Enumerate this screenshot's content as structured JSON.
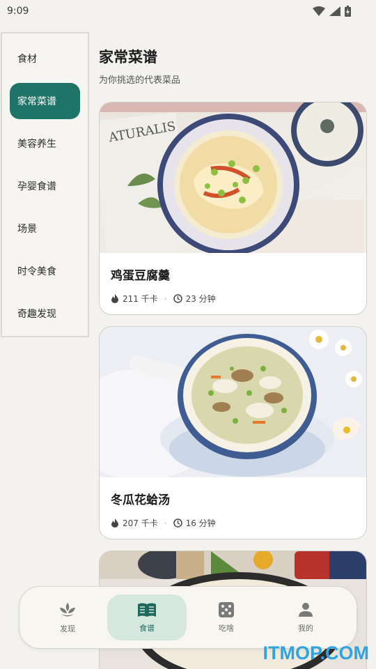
{
  "status_bar": {
    "time": "9:09"
  },
  "sidebar": {
    "items": [
      {
        "label": "食材"
      },
      {
        "label": "家常菜谱"
      },
      {
        "label": "美容养生"
      },
      {
        "label": "孕婴食谱"
      },
      {
        "label": "场景"
      },
      {
        "label": "时令美食"
      },
      {
        "label": "奇趣发现"
      }
    ],
    "active_index": 1
  },
  "header": {
    "title": "家常菜谱",
    "subtitle": "为你挑选的代表菜品"
  },
  "cards": [
    {
      "title": "鸡蛋豆腐羹",
      "calories": "211 千卡",
      "duration": "23 分钟",
      "image_icon": "dish-photo"
    },
    {
      "title": "冬瓜花蛤汤",
      "calories": "207 千卡",
      "duration": "16 分钟",
      "image_icon": "dish-photo"
    },
    {
      "image_icon": "dish-photo"
    }
  ],
  "bottom_nav": {
    "items": [
      {
        "label": "发现",
        "icon": "sprout-icon"
      },
      {
        "label": "食谱",
        "icon": "book-icon"
      },
      {
        "label": "吃啥",
        "icon": "dice-icon"
      },
      {
        "label": "我的",
        "icon": "person-icon"
      }
    ],
    "active_index": 1
  },
  "watermark": "ITMOP.COM",
  "colors": {
    "accent": "#1d7467",
    "nav_active_bg": "#d6e7df",
    "background": "#f3f2ee"
  }
}
